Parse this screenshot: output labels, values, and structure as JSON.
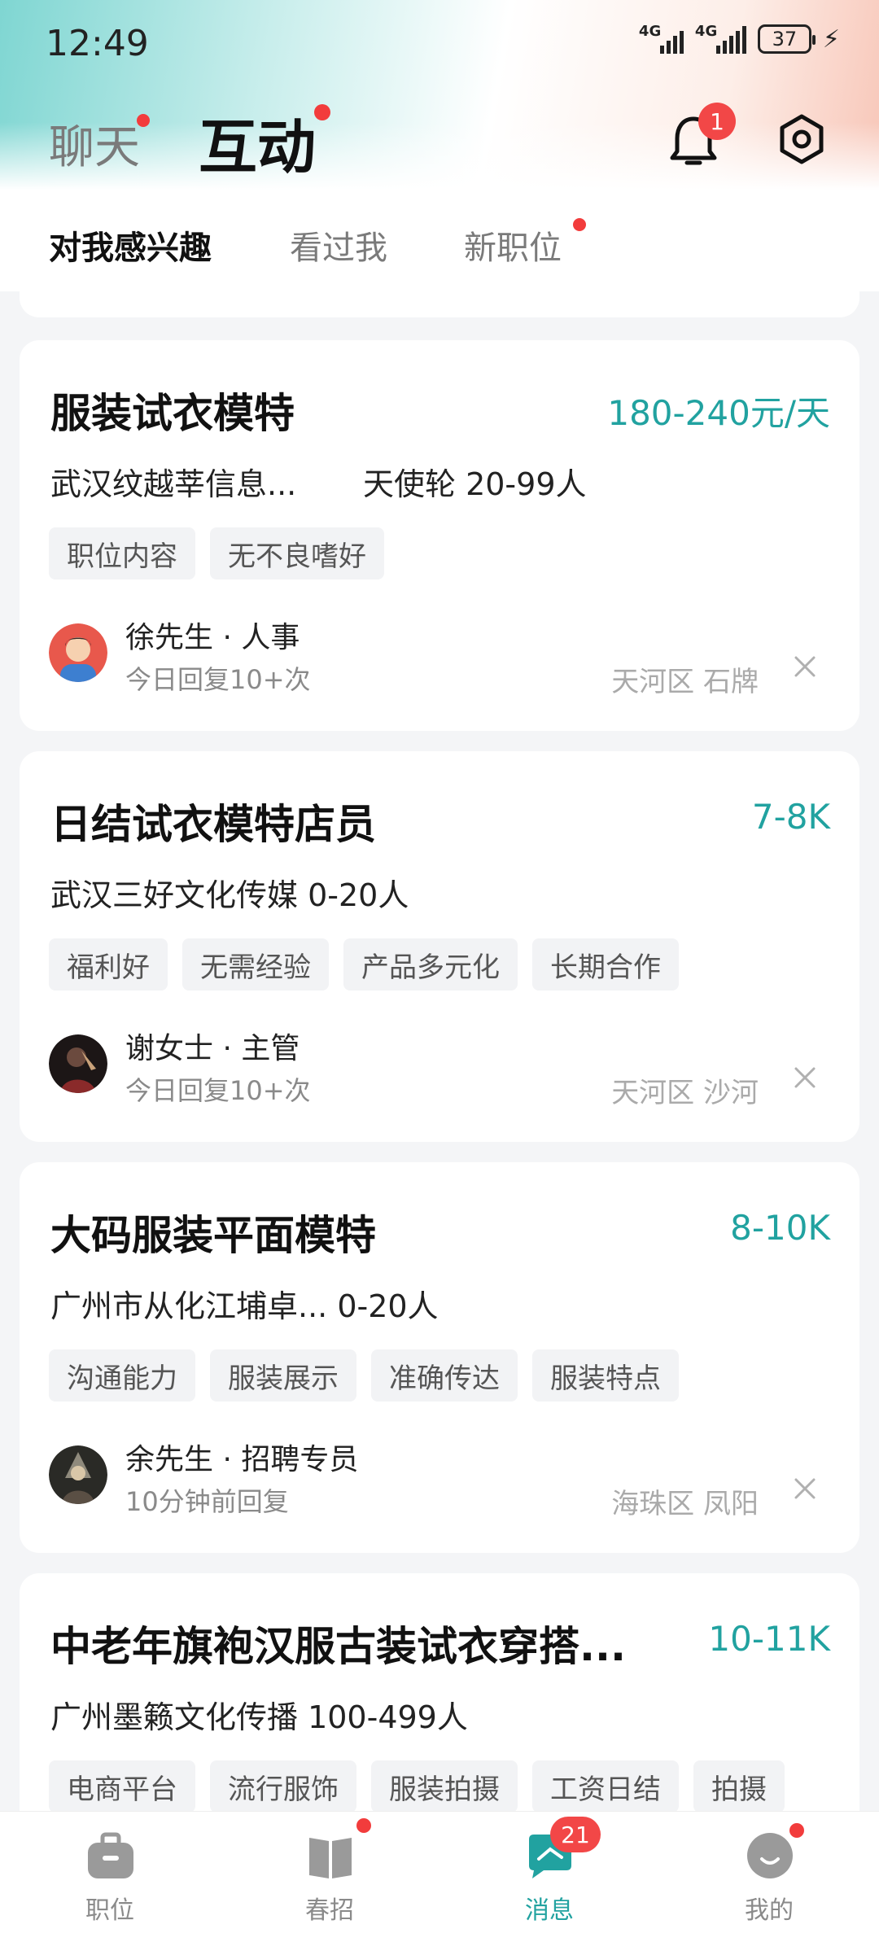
{
  "status_bar": {
    "time": "12:49",
    "network_1": "4G",
    "network_2": "4G",
    "battery": "37"
  },
  "top_nav": {
    "chat_label": "聊天",
    "interact_label": "互动",
    "notification_count": "1"
  },
  "sub_tabs": [
    {
      "label": "对我感兴趣",
      "active": true
    },
    {
      "label": "看过我",
      "active": false
    },
    {
      "label": "新职位",
      "active": false
    }
  ],
  "jobs": [
    {
      "title": "服装试衣模特",
      "salary": "180-240元/天",
      "company": "武汉纹越莘信息...",
      "company_extra": "天使轮  20-99人",
      "tags": [
        "职位内容",
        "无不良嗜好"
      ],
      "recruiter": "徐先生 · 人事",
      "reply": "今日回复10+次",
      "location": "天河区 石牌"
    },
    {
      "title": "日结试衣模特店员",
      "salary": "7-8K",
      "company": "武汉三好文化传媒  0-20人",
      "tags": [
        "福利好",
        "无需经验",
        "产品多元化",
        "长期合作"
      ],
      "recruiter": "谢女士 · 主管",
      "reply": "今日回复10+次",
      "location": "天河区 沙河"
    },
    {
      "title": "大码服装平面模特",
      "salary": "8-10K",
      "company": "广州市从化江埔卓...  0-20人",
      "tags": [
        "沟通能力",
        "服装展示",
        "准确传达",
        "服装特点"
      ],
      "recruiter": "余先生 · 招聘专员",
      "reply": "10分钟前回复",
      "location": "海珠区 凤阳"
    },
    {
      "title": "中老年旗袍汉服古装试衣穿搭...",
      "salary": "10-11K",
      "company": "广州墨籁文化传播  100-499人",
      "tags": [
        "电商平台",
        "流行服饰",
        "服装拍摄",
        "工资日结",
        "拍摄"
      ]
    }
  ],
  "bottom_nav": [
    {
      "label": "职位",
      "icon": "briefcase-icon"
    },
    {
      "label": "春招",
      "icon": "book-icon"
    },
    {
      "label": "消息",
      "icon": "message-icon",
      "badge": "21"
    },
    {
      "label": "我的",
      "icon": "profile-icon"
    }
  ],
  "colors": {
    "accent": "#21a2a0",
    "badge": "#f24747"
  }
}
